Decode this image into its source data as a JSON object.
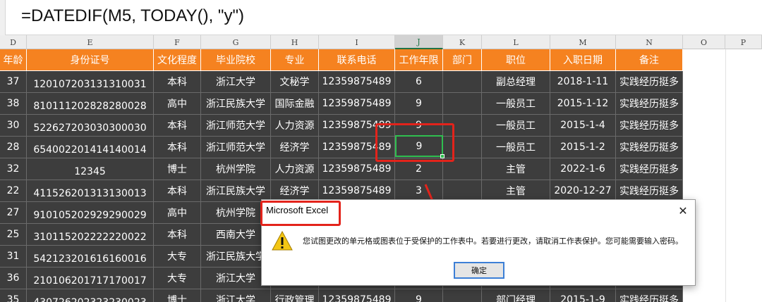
{
  "formula": "=DATEDIF(M5, TODAY(), \"y\")",
  "columns": [
    {
      "letter": "D",
      "header": "年龄"
    },
    {
      "letter": "E",
      "header": "身份证号"
    },
    {
      "letter": "F",
      "header": "文化程度"
    },
    {
      "letter": "G",
      "header": "毕业院校"
    },
    {
      "letter": "H",
      "header": "专业"
    },
    {
      "letter": "I",
      "header": "联系电话"
    },
    {
      "letter": "J",
      "header": "工作年限"
    },
    {
      "letter": "K",
      "header": "部门"
    },
    {
      "letter": "L",
      "header": "职位"
    },
    {
      "letter": "M",
      "header": "入职日期"
    },
    {
      "letter": "N",
      "header": "备注"
    },
    {
      "letter": "O",
      "header": ""
    },
    {
      "letter": "P",
      "header": ""
    }
  ],
  "rows": [
    [
      "37",
      "120107203131310031",
      "本科",
      "浙江大学",
      "文秘学",
      "12359875489",
      "6",
      "",
      "副总经理",
      "2018-1-11",
      "实践经历挺多"
    ],
    [
      "38",
      "810111202828280028",
      "高中",
      "浙江民族大学",
      "国际金融",
      "12359875489",
      "9",
      "",
      "一般员工",
      "2015-1-12",
      "实践经历挺多"
    ],
    [
      "30",
      "522627203030300030",
      "本科",
      "浙江师范大学",
      "人力资源",
      "12359875489",
      "9",
      "",
      "一般员工",
      "2015-1-4",
      "实践经历挺多"
    ],
    [
      "28",
      "654002201414140014",
      "本科",
      "浙江师范大学",
      "经济学",
      "12359875489",
      "9",
      "",
      "一般员工",
      "2015-1-2",
      "实践经历挺多"
    ],
    [
      "32",
      "12345",
      "博士",
      "杭州学院",
      "人力资源",
      "12359875489",
      "2",
      "",
      "主管",
      "2022-1-6",
      "实践经历挺多"
    ],
    [
      "22",
      "411526201313130013",
      "本科",
      "浙江民族大学",
      "经济学",
      "12359875489",
      "3",
      "",
      "主管",
      "2020-12-27",
      "实践经历挺多"
    ],
    [
      "27",
      "910105202929290029",
      "高中",
      "杭州学院",
      "",
      "",
      "",
      "",
      "",
      "",
      ""
    ],
    [
      "25",
      "310115202222220022",
      "本科",
      "西南大学",
      "",
      "",
      "",
      "",
      "",
      "",
      ""
    ],
    [
      "31",
      "542123201616160016",
      "大专",
      "浙江民族大学",
      "",
      "",
      "",
      "",
      "",
      "",
      ""
    ],
    [
      "36",
      "210106201717170017",
      "大专",
      "浙江大学",
      "",
      "",
      "",
      "",
      "",
      "",
      ""
    ],
    [
      "35",
      "430726202323230023",
      "博士",
      "浙江大学",
      "行政管理",
      "12359875489",
      "9",
      "",
      "部门经理",
      "2015-1-9",
      "实践经历挺多"
    ]
  ],
  "active_cell_value": "9",
  "dialog": {
    "title": "Microsoft Excel",
    "close": "✕",
    "message": "您试图更改的单元格或图表位于受保护的工作表中。若要进行更改，请取消工作表保护。您可能需要输入密码。",
    "ok": "确定",
    "icon": "warning-icon"
  },
  "colors": {
    "header_orange": "#f58220",
    "cell_dark": "#3d3d3d",
    "annotation_red": "#e3231b",
    "active_green": "#2fbf4f"
  }
}
